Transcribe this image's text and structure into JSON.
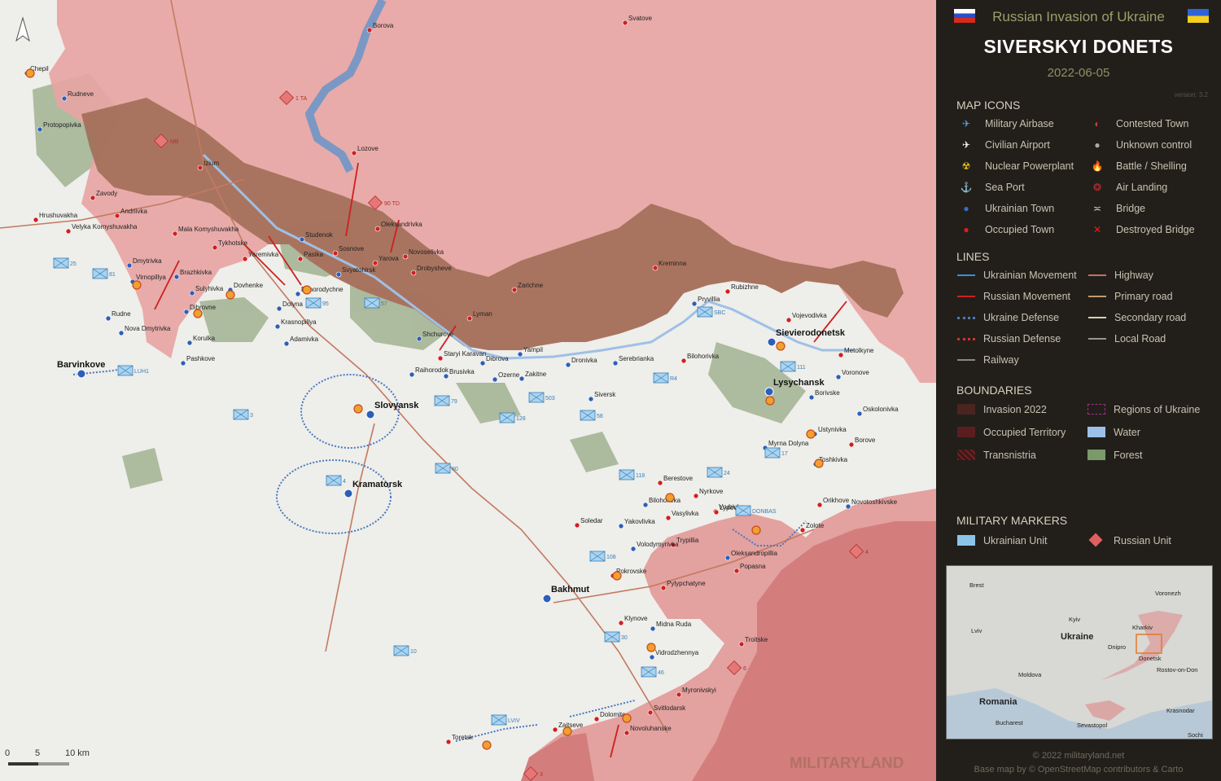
{
  "header": {
    "subtitle": "Russian Invasion of Ukraine",
    "title": "SIVERSKYI DONETS",
    "date": "2022-06-05",
    "version": "version: 3.2"
  },
  "legend": {
    "map_icons_title": "MAP ICONS",
    "map_icons": [
      {
        "icon": "military-airbase-icon",
        "label": "Military Airbase"
      },
      {
        "icon": "contested-town-icon",
        "label": "Contested Town"
      },
      {
        "icon": "civilian-airport-icon",
        "label": "Civilian Airport"
      },
      {
        "icon": "unknown-control-icon",
        "label": "Unknown control"
      },
      {
        "icon": "nuclear-powerplant-icon",
        "label": "Nuclear Powerplant"
      },
      {
        "icon": "battle-shelling-icon",
        "label": "Battle / Shelling"
      },
      {
        "icon": "sea-port-icon",
        "label": "Sea Port"
      },
      {
        "icon": "air-landing-icon",
        "label": "Air Landing"
      },
      {
        "icon": "ukrainian-town-icon",
        "label": "Ukrainian Town"
      },
      {
        "icon": "bridge-icon",
        "label": "Bridge"
      },
      {
        "icon": "occupied-town-icon",
        "label": "Occupied Town"
      },
      {
        "icon": "destroyed-bridge-icon",
        "label": "Destroyed Bridge"
      }
    ],
    "lines_title": "LINES",
    "lines": [
      {
        "label": "Ukrainian Movement",
        "color": "#3a8fd8"
      },
      {
        "label": "Highway",
        "color": "#c0725a"
      },
      {
        "label": "Russian Movement",
        "color": "#d02020"
      },
      {
        "label": "Primary road",
        "color": "#c29a6a"
      },
      {
        "label": "Ukraine Defense",
        "color": "#4a78c0"
      },
      {
        "label": "Secondary road",
        "color": "#d8d0b0"
      },
      {
        "label": "Russian Defense",
        "color": "#d83030"
      },
      {
        "label": "Local Road",
        "color": "#9a958a"
      },
      {
        "label": "Railway",
        "color": "#888888"
      }
    ],
    "boundaries_title": "BOUNDARIES",
    "boundaries": [
      {
        "label": "Invasion 2022",
        "color": "#4a2520"
      },
      {
        "label": "Regions of Ukraine",
        "color": "#a0308a"
      },
      {
        "label": "Occupied Territory",
        "color": "#5a1e1e"
      },
      {
        "label": "Water",
        "color": "#9cc0e8"
      },
      {
        "label": "Transnistria",
        "color": "#7a2020"
      },
      {
        "label": "Forest",
        "color": "#7a9a6a"
      }
    ],
    "markers_title": "MILITARY MARKERS",
    "markers": [
      {
        "label": "Ukrainian Unit",
        "color": "#8cc4e8"
      },
      {
        "label": "Russian Unit",
        "color": "#e06060"
      }
    ]
  },
  "inset": {
    "labels": [
      "Brest",
      "Voronezh",
      "Kyiv",
      "Lviv",
      "Ukraine",
      "Kharkiv",
      "Dnipro",
      "Donetsk",
      "Rostov-on-Don",
      "Moldova",
      "Romania",
      "Krasnodar",
      "Bucharest",
      "Sevastopol",
      "Sochi"
    ]
  },
  "footer": {
    "copyright": "© 2022 militaryland.net",
    "basemap": "Base map by © OpenStreetMap contributors & Carto",
    "scale_labels": [
      "0",
      "5",
      "10 km"
    ],
    "watermark": "MILITARYLAND"
  },
  "map": {
    "cities": [
      {
        "name": "Barvinkove"
      },
      {
        "name": "Slovyansk"
      },
      {
        "name": "Kramatorsk"
      },
      {
        "name": "Bakhmut"
      },
      {
        "name": "Lysychansk"
      },
      {
        "name": "Sievierodonetsk"
      }
    ],
    "towns": [
      {
        "name": "Borova"
      },
      {
        "name": "Svatove"
      },
      {
        "name": "Chepil"
      },
      {
        "name": "Rudneve"
      },
      {
        "name": "Protopopivka"
      },
      {
        "name": "Izium"
      },
      {
        "name": "Zavody"
      },
      {
        "name": "Andriivka"
      },
      {
        "name": "Hrushuvakha"
      },
      {
        "name": "Velyka Komyshuvakha"
      },
      {
        "name": "Mala Komyshuvakha"
      },
      {
        "name": "Tykhotske"
      },
      {
        "name": "Lozove"
      },
      {
        "name": "Oleksandrivka"
      },
      {
        "name": "Studenok"
      },
      {
        "name": "Sosnove"
      },
      {
        "name": "Pasika"
      },
      {
        "name": "Yaremivka"
      },
      {
        "name": "Novoselivka"
      },
      {
        "name": "Yarova"
      },
      {
        "name": "Svyatohirsk"
      },
      {
        "name": "Drobysheve"
      },
      {
        "name": "Dmytrivka"
      },
      {
        "name": "Virnopillya"
      },
      {
        "name": "Brazhkivka"
      },
      {
        "name": "Sulyhivka"
      },
      {
        "name": "Dovhenke"
      },
      {
        "name": "Bohorodychne"
      },
      {
        "name": "Dolyna"
      },
      {
        "name": "Krasnopillya"
      },
      {
        "name": "Dibrovne"
      },
      {
        "name": "Rudne"
      },
      {
        "name": "Nova Dmytrivka"
      },
      {
        "name": "Korulka"
      },
      {
        "name": "Adamivka"
      },
      {
        "name": "Pashkove"
      },
      {
        "name": "Zarichne"
      },
      {
        "name": "Lyman"
      },
      {
        "name": "Shchurove"
      },
      {
        "name": "Staryi Karavan"
      },
      {
        "name": "Raihorodok"
      },
      {
        "name": "Brusivka"
      },
      {
        "name": "Dibrova"
      },
      {
        "name": "Ozerne"
      },
      {
        "name": "Zakitne"
      },
      {
        "name": "Yampil"
      },
      {
        "name": "Dronivka"
      },
      {
        "name": "Serebrianka"
      },
      {
        "name": "Bilohorivka"
      },
      {
        "name": "Kreminna"
      },
      {
        "name": "Rubizhne"
      },
      {
        "name": "Pryvillia"
      },
      {
        "name": "Vojevodivka"
      },
      {
        "name": "Metolkyne"
      },
      {
        "name": "Voronove"
      },
      {
        "name": "Borivske"
      },
      {
        "name": "Oskolonivka"
      },
      {
        "name": "Ustynivka"
      },
      {
        "name": "Borove"
      },
      {
        "name": "Myrna Dolyna"
      },
      {
        "name": "Toshkivka"
      },
      {
        "name": "Siversk"
      },
      {
        "name": "Berestove"
      },
      {
        "name": "Nyrkove"
      },
      {
        "name": "Vrubivka"
      },
      {
        "name": "Lypove"
      },
      {
        "name": "Vasylivka"
      },
      {
        "name": "Trypillia"
      },
      {
        "name": "Bilohorivka"
      },
      {
        "name": "Yakovlivka"
      },
      {
        "name": "Soledar"
      },
      {
        "name": "Orikhove"
      },
      {
        "name": "Novotoshkivske"
      },
      {
        "name": "Zolote"
      },
      {
        "name": "Volodymyrivka"
      },
      {
        "name": "Oleksandropillia"
      },
      {
        "name": "Popasna"
      },
      {
        "name": "Pokrovske"
      },
      {
        "name": "Pylypchatyne"
      },
      {
        "name": "Klynove"
      },
      {
        "name": "Midna Ruda"
      },
      {
        "name": "Troitske"
      },
      {
        "name": "Vidrodzhennya"
      },
      {
        "name": "Myronivskyi"
      },
      {
        "name": "Svitlodarsk"
      },
      {
        "name": "Dolomite"
      },
      {
        "name": "Zaitseve"
      },
      {
        "name": "Novoluhanske"
      },
      {
        "name": "Toretsk"
      }
    ],
    "ukr_units": [
      "25",
      "81",
      "95",
      "57",
      "79",
      "503",
      "128",
      "58",
      "R4",
      "3",
      "LUH1",
      "4",
      "80",
      "118",
      "24",
      "108",
      "10",
      "30",
      "46",
      "LVIV",
      "17",
      "DONBAS",
      "111",
      "SBC"
    ],
    "rus_units": [
      "1 TA",
      "MB",
      "90 TD",
      "6",
      "3",
      "4"
    ]
  }
}
